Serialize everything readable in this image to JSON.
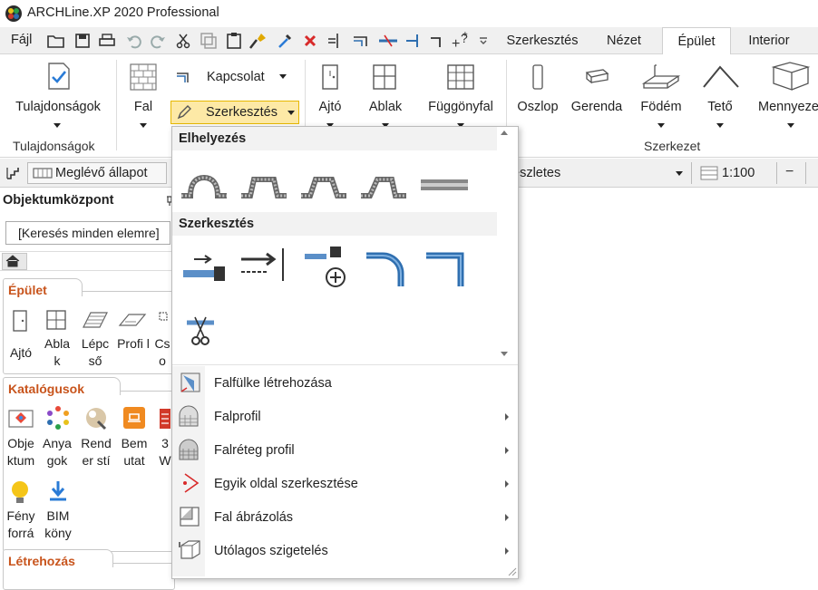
{
  "app": {
    "title": "ARCHLine.XP 2020  Professional"
  },
  "menubar": {
    "file": "Fájl"
  },
  "tabs": [
    "Szerkesztés",
    "Nézet",
    "Épület",
    "Interior"
  ],
  "ribbon": {
    "properties": "Tulajdonságok",
    "properties_group": "Tulajdonságok",
    "wall": "Fal",
    "connection": "Kapcsolat",
    "edit": "Szerkesztés",
    "door": "Ajtó",
    "window": "Ablak",
    "curtain_wall": "Függönyfal",
    "column": "Oszlop",
    "beam": "Gerenda",
    "slab": "Födém",
    "roof": "Tető",
    "more": "Mennyeze",
    "structure_group": "Szerkezet"
  },
  "toolbar2": {
    "state": "Meglévő állapot",
    "detail": "észletes",
    "scale": "1:100"
  },
  "panel": {
    "title": "Objektumközpont",
    "search_placeholder": "[Keresés minden elemre]",
    "sections": [
      {
        "title": "Épület",
        "items": [
          "Ajtó",
          "Abla k",
          "Lépc ső",
          "Profi l",
          "Cs o"
        ]
      },
      {
        "title": "Katalógusok",
        "items": [
          "Obje ktum",
          "Anya gok",
          "Rend er stí",
          "Bem utat",
          "3 W",
          "Fény forrá",
          "BIM köny"
        ]
      },
      {
        "title": "Létrehozás",
        "items": []
      }
    ]
  },
  "dropdown": {
    "placement_header": "Elhelyezés",
    "edit_header": "Szerkesztés",
    "menu": [
      {
        "label": "Falfülke létrehozása",
        "submenu": false
      },
      {
        "label": "Falprofil",
        "submenu": true
      },
      {
        "label": "Falréteg profil",
        "submenu": true
      },
      {
        "label": "Egyik oldal szerkesztése",
        "submenu": true
      },
      {
        "label": "Fal ábrázolás",
        "submenu": true
      },
      {
        "label": "Utólagos szigetelés",
        "submenu": true
      }
    ]
  },
  "colors": {
    "accent_orange": "#c8541c",
    "active_button": "#fde9a6",
    "wall_blue": "#2f6fb0"
  }
}
